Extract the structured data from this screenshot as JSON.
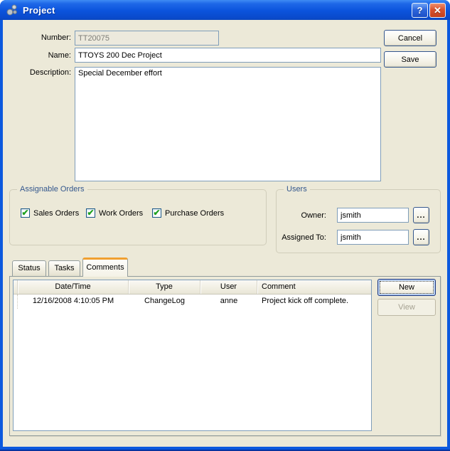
{
  "window": {
    "title": "Project",
    "help_glyph": "?",
    "close_glyph": "✕"
  },
  "form": {
    "number": {
      "label": "Number:",
      "value": "TT20075",
      "disabled": true
    },
    "name": {
      "label": "Name:",
      "value": "TTOYS 200 Dec Project"
    },
    "description": {
      "label": "Description:",
      "value": "Special December effort"
    }
  },
  "actions": {
    "cancel_label": "Cancel",
    "save_label": "Save"
  },
  "assignable_orders": {
    "title": "Assignable Orders",
    "items": [
      {
        "label": "Sales Orders",
        "checked": true
      },
      {
        "label": "Work Orders",
        "checked": true
      },
      {
        "label": "Purchase Orders",
        "checked": true
      }
    ],
    "check_glyph": "✔"
  },
  "users": {
    "title": "Users",
    "owner": {
      "label": "Owner:",
      "value": "jsmith",
      "browse_label": "..."
    },
    "assigned_to": {
      "label": "Assigned To:",
      "value": "jsmith",
      "browse_label": "..."
    }
  },
  "tabs": [
    {
      "label": "Status",
      "active": false
    },
    {
      "label": "Tasks",
      "active": false
    },
    {
      "label": "Comments",
      "active": true
    }
  ],
  "comments_table": {
    "columns": [
      "Date/Time",
      "Type",
      "User",
      "Comment"
    ],
    "rows": [
      [
        "12/16/2008 4:10:05 PM",
        "ChangeLog",
        "anne",
        "Project kick off complete."
      ]
    ]
  },
  "table_actions": {
    "new_label": "New",
    "view_label": "View"
  },
  "colors": {
    "titlebar_blue": "#0B53DC",
    "window_border": "#0C59DE",
    "dialog_bg": "#ECE9D8",
    "field_border": "#7F9DB9",
    "group_caption": "#33578D",
    "active_tab_accent": "#F0A030",
    "check_green": "#1FA11F",
    "close_red": "#D9522E"
  }
}
